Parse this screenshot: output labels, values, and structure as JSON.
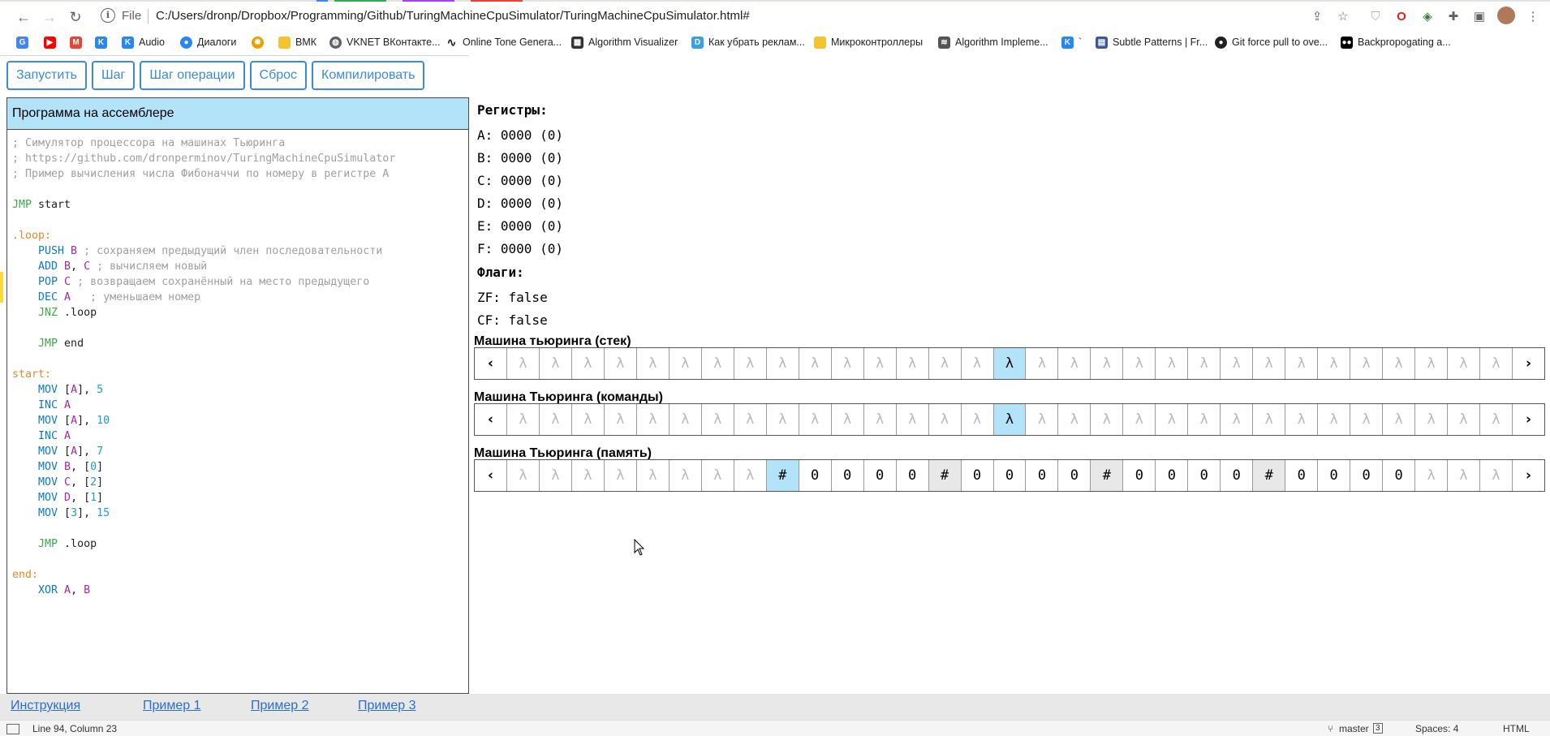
{
  "browser": {
    "url_scheme": "File",
    "url": "C:/Users/dronp/Dropbox/Programming/Github/TuringMachineCpuSimulator/TuringMachineCpuSimulator.html#",
    "tab_marks": [
      "#4285f4",
      "#34a853",
      "#a142f4",
      "#ea4335"
    ],
    "nav": {
      "back": "←",
      "forward": "→",
      "reload": "↻"
    },
    "toolbar_icons": [
      "share-icon",
      "star-icon",
      "shield-icon",
      "opera-icon",
      "extension-icon",
      "puzzle-icon",
      "sidepanel-icon",
      "avatar",
      "menu-icon"
    ],
    "bookmarks": [
      {
        "label": "",
        "icon": "translate-icon",
        "color": "#4285f4"
      },
      {
        "label": "",
        "icon": "youtube-icon",
        "color": "#ff0000"
      },
      {
        "label": "",
        "icon": "gmail-icon",
        "color": "#ea4335"
      },
      {
        "label": "",
        "icon": "vk-icon",
        "color": "#2787f5"
      },
      {
        "label": "Audio",
        "icon": "vk-icon",
        "color": "#2787f5"
      },
      {
        "label": "Диалоги",
        "icon": "chat-icon",
        "color": "#2787f5"
      },
      {
        "label": "",
        "icon": "gear-icon",
        "color": "#e8a000"
      },
      {
        "label": "ВМК",
        "icon": "folder-icon",
        "color": "#f4c430"
      },
      {
        "label": "VKNET ВКонтакте...",
        "icon": "globe-icon",
        "color": "#5f6368"
      },
      {
        "label": "Online Tone Genera...",
        "icon": "wave-icon",
        "color": "#202124"
      },
      {
        "label": "Algorithm Visualizer",
        "icon": "algo-icon",
        "color": "#333333"
      },
      {
        "label": "Как убрать реклам...",
        "icon": "page-icon",
        "color": "#3aa0e0"
      },
      {
        "label": "Микроконтроллеры",
        "icon": "folder-icon",
        "color": "#f4c430"
      },
      {
        "label": "Algorithm Impleme...",
        "icon": "stack-icon",
        "color": "#555555"
      },
      {
        "label": "`",
        "icon": "vk-icon",
        "color": "#2787f5"
      },
      {
        "label": "Subtle Patterns | Fr...",
        "icon": "book-icon",
        "color": "#3b5998"
      },
      {
        "label": "Git force pull to ove...",
        "icon": "github-icon",
        "color": "#202124"
      },
      {
        "label": "Backpropogating a...",
        "icon": "medium-icon",
        "color": "#000000"
      }
    ],
    "bookmarks_more": "»"
  },
  "controls": {
    "run": "Запустить",
    "step": "Шаг",
    "op_step": "Шаг операции",
    "reset": "Сброс",
    "compile": "Компилировать"
  },
  "editor": {
    "title": "Программа на ассемблере",
    "lines": [
      [
        {
          "t": "; Симулятор процессора на машинах Тьюринга",
          "c": "com"
        }
      ],
      [
        {
          "t": "; https://github.com/dronperminov/TuringMachineCpuSimulator",
          "c": "com"
        }
      ],
      [
        {
          "t": "; Пример вычисления числа Фибоначчи по номеру в регистре A",
          "c": "com"
        }
      ],
      [],
      [
        {
          "t": "JMP",
          "c": "kw"
        },
        {
          "t": " start",
          "c": "txt"
        }
      ],
      [],
      [
        {
          "t": ".loop:",
          "c": "lbl"
        }
      ],
      [
        {
          "t": "    PUSH",
          "c": "inst"
        },
        {
          "t": " B",
          "c": "op"
        },
        {
          "t": " ; сохраняем предыдущий член последовательности",
          "c": "com"
        }
      ],
      [
        {
          "t": "    ADD",
          "c": "inst"
        },
        {
          "t": " B",
          "c": "op"
        },
        {
          "t": ", ",
          "c": "txt"
        },
        {
          "t": "C",
          "c": "op"
        },
        {
          "t": " ; вычисляем новый",
          "c": "com"
        }
      ],
      [
        {
          "t": "    POP",
          "c": "inst"
        },
        {
          "t": " C",
          "c": "op"
        },
        {
          "t": " ; возвращаем сохранённый на место предыдущего",
          "c": "com"
        }
      ],
      [
        {
          "t": "    DEC",
          "c": "inst"
        },
        {
          "t": " A",
          "c": "op"
        },
        {
          "t": "   ; уменьшаем номер",
          "c": "com"
        }
      ],
      [
        {
          "t": "    JNZ",
          "c": "kw"
        },
        {
          "t": " .loop",
          "c": "txt"
        }
      ],
      [],
      [
        {
          "t": "    JMP",
          "c": "kw"
        },
        {
          "t": " end",
          "c": "txt"
        }
      ],
      [],
      [
        {
          "t": "start:",
          "c": "lbl"
        }
      ],
      [
        {
          "t": "    MOV",
          "c": "inst"
        },
        {
          "t": " [",
          "c": "txt"
        },
        {
          "t": "A",
          "c": "op"
        },
        {
          "t": "], ",
          "c": "txt"
        },
        {
          "t": "5",
          "c": "num"
        }
      ],
      [
        {
          "t": "    INC",
          "c": "inst"
        },
        {
          "t": " A",
          "c": "op"
        }
      ],
      [
        {
          "t": "    MOV",
          "c": "inst"
        },
        {
          "t": " [",
          "c": "txt"
        },
        {
          "t": "A",
          "c": "op"
        },
        {
          "t": "], ",
          "c": "txt"
        },
        {
          "t": "10",
          "c": "num"
        }
      ],
      [
        {
          "t": "    INC",
          "c": "inst"
        },
        {
          "t": " A",
          "c": "op"
        }
      ],
      [
        {
          "t": "    MOV",
          "c": "inst"
        },
        {
          "t": " [",
          "c": "txt"
        },
        {
          "t": "A",
          "c": "op"
        },
        {
          "t": "], ",
          "c": "txt"
        },
        {
          "t": "7",
          "c": "num"
        }
      ],
      [
        {
          "t": "    MOV",
          "c": "inst"
        },
        {
          "t": " B",
          "c": "op"
        },
        {
          "t": ", [",
          "c": "txt"
        },
        {
          "t": "0",
          "c": "num"
        },
        {
          "t": "]",
          "c": "txt"
        }
      ],
      [
        {
          "t": "    MOV",
          "c": "inst"
        },
        {
          "t": " C",
          "c": "op"
        },
        {
          "t": ", [",
          "c": "txt"
        },
        {
          "t": "2",
          "c": "num"
        },
        {
          "t": "]",
          "c": "txt"
        }
      ],
      [
        {
          "t": "    MOV",
          "c": "inst"
        },
        {
          "t": " D",
          "c": "op"
        },
        {
          "t": ", [",
          "c": "txt"
        },
        {
          "t": "1",
          "c": "num"
        },
        {
          "t": "]",
          "c": "txt"
        }
      ],
      [
        {
          "t": "    MOV",
          "c": "inst"
        },
        {
          "t": " [",
          "c": "txt"
        },
        {
          "t": "3",
          "c": "num"
        },
        {
          "t": "], ",
          "c": "txt"
        },
        {
          "t": "15",
          "c": "num"
        }
      ],
      [],
      [
        {
          "t": "    JMP",
          "c": "kw"
        },
        {
          "t": " .loop",
          "c": "txt"
        }
      ],
      [],
      [
        {
          "t": "end:",
          "c": "lbl"
        }
      ],
      [
        {
          "t": "    XOR",
          "c": "inst"
        },
        {
          "t": " A",
          "c": "op"
        },
        {
          "t": ", ",
          "c": "txt"
        },
        {
          "t": "B",
          "c": "op"
        }
      ]
    ]
  },
  "registers": {
    "title": "Регистры:",
    "items": [
      {
        "name": "A",
        "value": "0000",
        "dec": "(0)"
      },
      {
        "name": "B",
        "value": "0000",
        "dec": "(0)"
      },
      {
        "name": "C",
        "value": "0000",
        "dec": "(0)"
      },
      {
        "name": "D",
        "value": "0000",
        "dec": "(0)"
      },
      {
        "name": "E",
        "value": "0000",
        "dec": "(0)"
      },
      {
        "name": "F",
        "value": "0000",
        "dec": "(0)"
      }
    ]
  },
  "flags": {
    "title": "Флаги:",
    "items": [
      {
        "name": "ZF",
        "value": "false"
      },
      {
        "name": "CF",
        "value": "false"
      }
    ]
  },
  "machines": [
    {
      "title": "Машина тьюринга (стек)",
      "left": "‹",
      "right": "›",
      "cells": [
        "λ",
        "λ",
        "λ",
        "λ",
        "λ",
        "λ",
        "λ",
        "λ",
        "λ",
        "λ",
        "λ",
        "λ",
        "λ",
        "λ",
        "λ",
        "λ",
        "λ",
        "λ",
        "λ",
        "λ",
        "λ",
        "λ",
        "λ",
        "λ",
        "λ",
        "λ",
        "λ",
        "λ",
        "λ",
        "λ",
        "λ"
      ],
      "head": 15,
      "separators": []
    },
    {
      "title": "Машина Тьюринга (команды)",
      "left": "‹",
      "right": "›",
      "cells": [
        "λ",
        "λ",
        "λ",
        "λ",
        "λ",
        "λ",
        "λ",
        "λ",
        "λ",
        "λ",
        "λ",
        "λ",
        "λ",
        "λ",
        "λ",
        "λ",
        "λ",
        "λ",
        "λ",
        "λ",
        "λ",
        "λ",
        "λ",
        "λ",
        "λ",
        "λ",
        "λ",
        "λ",
        "λ",
        "λ",
        "λ"
      ],
      "head": 15,
      "separators": []
    },
    {
      "title": "Машина Тьюринга (память)",
      "left": "‹",
      "right": "›",
      "cells": [
        "λ",
        "λ",
        "λ",
        "λ",
        "λ",
        "λ",
        "λ",
        "λ",
        "#",
        "0",
        "0",
        "0",
        "0",
        "#",
        "0",
        "0",
        "0",
        "0",
        "#",
        "0",
        "0",
        "0",
        "0",
        "#",
        "0",
        "0",
        "0",
        "0",
        "λ",
        "λ",
        "λ"
      ],
      "head": 8,
      "separators": [
        13,
        18,
        23
      ]
    }
  ],
  "links": [
    "Инструкция",
    "Пример 1",
    "Пример 2",
    "Пример 3"
  ],
  "statusbar": {
    "position": "Line 94, Column 23",
    "branch": "master",
    "branch_count": "3",
    "spaces": "Spaces: 4",
    "language": "HTML"
  }
}
